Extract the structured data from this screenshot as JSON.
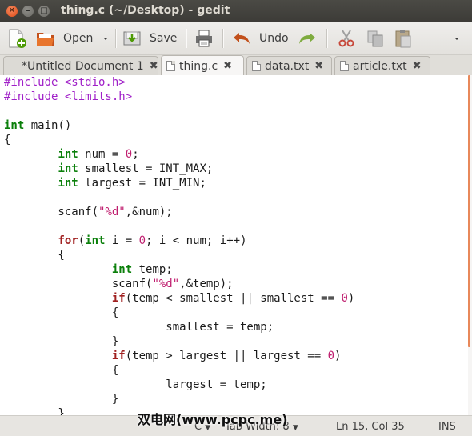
{
  "window": {
    "title": "thing.c (~/Desktop) - gedit"
  },
  "toolbar": {
    "open_label": "Open",
    "save_label": "Save",
    "undo_label": "Undo"
  },
  "tabs": [
    {
      "label": "*Untitled Document 1"
    },
    {
      "label": "thing.c"
    },
    {
      "label": "data.txt"
    },
    {
      "label": "article.txt"
    }
  ],
  "editor": {
    "lines": [
      "#include <stdio.h>",
      "#include <limits.h>",
      "",
      "int main()",
      "{",
      "        int num = 0;",
      "        int smallest = INT_MAX;",
      "        int largest = INT_MIN;",
      "",
      "        scanf(\"%d\",&num);",
      "",
      "        for(int i = 0; i < num; i++)",
      "        {",
      "                int temp;",
      "                scanf(\"%d\",&temp);",
      "                if(temp < smallest || smallest == 0)",
      "                {",
      "                        smallest = temp;",
      "                }",
      "                if(temp > largest || largest == 0)",
      "                {",
      "                        largest = temp;",
      "                }",
      "        }"
    ]
  },
  "statusbar": {
    "language": "C",
    "tab_width": "Tab Width:  8",
    "position": "Ln 15, Col 35",
    "mode": "INS"
  },
  "watermark": "双电网(www.pcpc.me)",
  "colors": {
    "title_bar": "#3c3b37",
    "scroll_thumb": "#e8885a",
    "keyword": "#0a7f0a",
    "preprocessor": "#a020c8",
    "string": "#c02070"
  }
}
